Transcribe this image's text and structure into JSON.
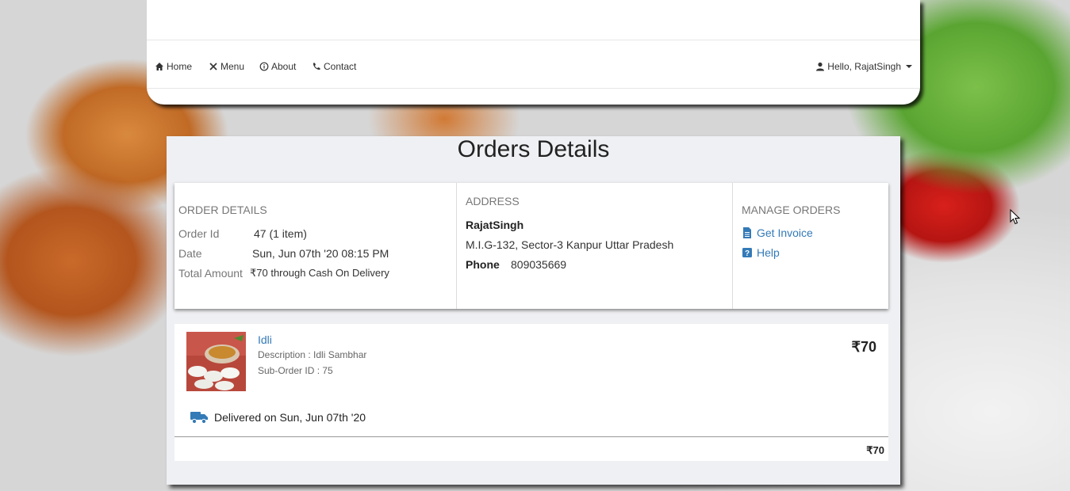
{
  "nav": {
    "home": "Home",
    "menu": "Menu",
    "about": "About",
    "contact": "Contact",
    "user": "Hello, RajatSingh"
  },
  "page": {
    "title": "Orders Details"
  },
  "order_details": {
    "heading": "ORDER DETAILS",
    "order_id_label": "Order Id",
    "order_id_value": "47 (1 item)",
    "date_label": "Date",
    "date_value": "Sun, Jun 07th '20 08:15 PM",
    "total_label": "Total Amount",
    "total_value": "₹70 through Cash On Delivery"
  },
  "address": {
    "heading": "ADDRESS",
    "name": "RajatSingh",
    "line": "M.I.G-132, Sector-3 Kanpur Uttar Pradesh",
    "phone_label": "Phone",
    "phone_value": "809035669"
  },
  "manage": {
    "heading": "MANAGE ORDERS",
    "invoice": "Get Invoice",
    "help": "Help"
  },
  "item": {
    "name": "Idli",
    "description": "Description : Idli Sambhar",
    "sub_order": "Sub-Order ID : 75",
    "price": "₹70",
    "delivery": "Delivered on Sun, Jun 07th '20",
    "total": "₹70"
  },
  "colors": {
    "link": "#337ab7",
    "panel_bg": "#eff0f3"
  },
  "icons": [
    "home-icon",
    "cutlery-icon",
    "info-icon",
    "phone-icon",
    "user-icon",
    "document-icon",
    "help-icon",
    "truck-icon"
  ]
}
